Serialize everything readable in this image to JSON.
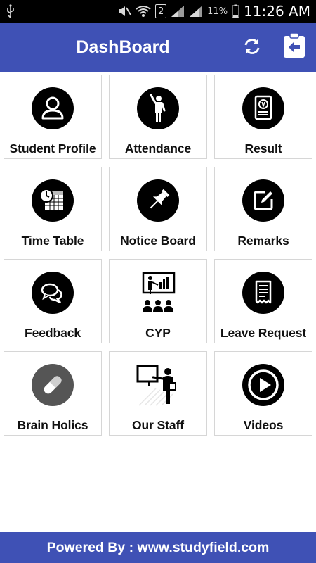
{
  "status_bar": {
    "sim_slot": "2",
    "battery_percent": "11%",
    "time": "11:26 AM"
  },
  "app_bar": {
    "title": "DashBoard",
    "refresh_icon": "refresh-icon",
    "logout_icon": "logout-clipboard-icon"
  },
  "tiles": [
    {
      "label": "Student Profile",
      "icon": "user-profile-icon"
    },
    {
      "label": "Attendance",
      "icon": "person-raising-hand-icon"
    },
    {
      "label": "Result",
      "icon": "result-certificate-icon"
    },
    {
      "label": "Time Table",
      "icon": "clock-calendar-icon"
    },
    {
      "label": "Notice Board",
      "icon": "pushpin-icon"
    },
    {
      "label": "Remarks",
      "icon": "edit-note-icon"
    },
    {
      "label": "Feedback",
      "icon": "chat-bubbles-icon"
    },
    {
      "label": "CYP",
      "icon": "presentation-board-icon"
    },
    {
      "label": "Leave Request",
      "icon": "receipt-document-icon"
    },
    {
      "label": "Brain Holics",
      "icon": "capsule-pill-icon"
    },
    {
      "label": "Our Staff",
      "icon": "teacher-board-icon"
    },
    {
      "label": "Videos",
      "icon": "play-circle-icon"
    }
  ],
  "footer": {
    "text": "Powered By : www.studyfield.com"
  },
  "colors": {
    "primary": "#3f51b5",
    "icon_fill": "#000000",
    "brain_holics_fill": "#555555"
  }
}
